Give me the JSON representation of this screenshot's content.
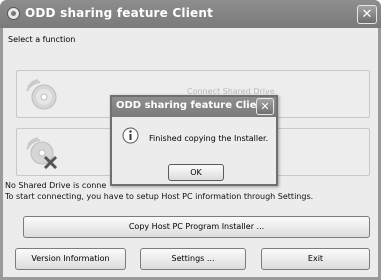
{
  "window": {
    "title": "ODD sharing feature Client",
    "close_glyph": "✕"
  },
  "main": {
    "prompt": "Select a function",
    "panels": [
      {
        "label": "Connect Shared Drive",
        "icon": "disc-share-icon"
      },
      {
        "label": "",
        "icon": "disc-disconnect-icon"
      }
    ],
    "status_line1": "No Shared Drive is conne",
    "status_line2": "To start connecting, you have to setup Host PC information through Settings.",
    "copy_installer_label": "Copy Host PC Program Installer ...",
    "version_label": "Version Information",
    "settings_label": "Settings ...",
    "exit_label": "Exit"
  },
  "dialog": {
    "title": "ODD sharing feature Client",
    "close_glyph": "✕",
    "icon": "info-icon",
    "message": "Finished copying the Installer.",
    "ok_label": "OK"
  }
}
